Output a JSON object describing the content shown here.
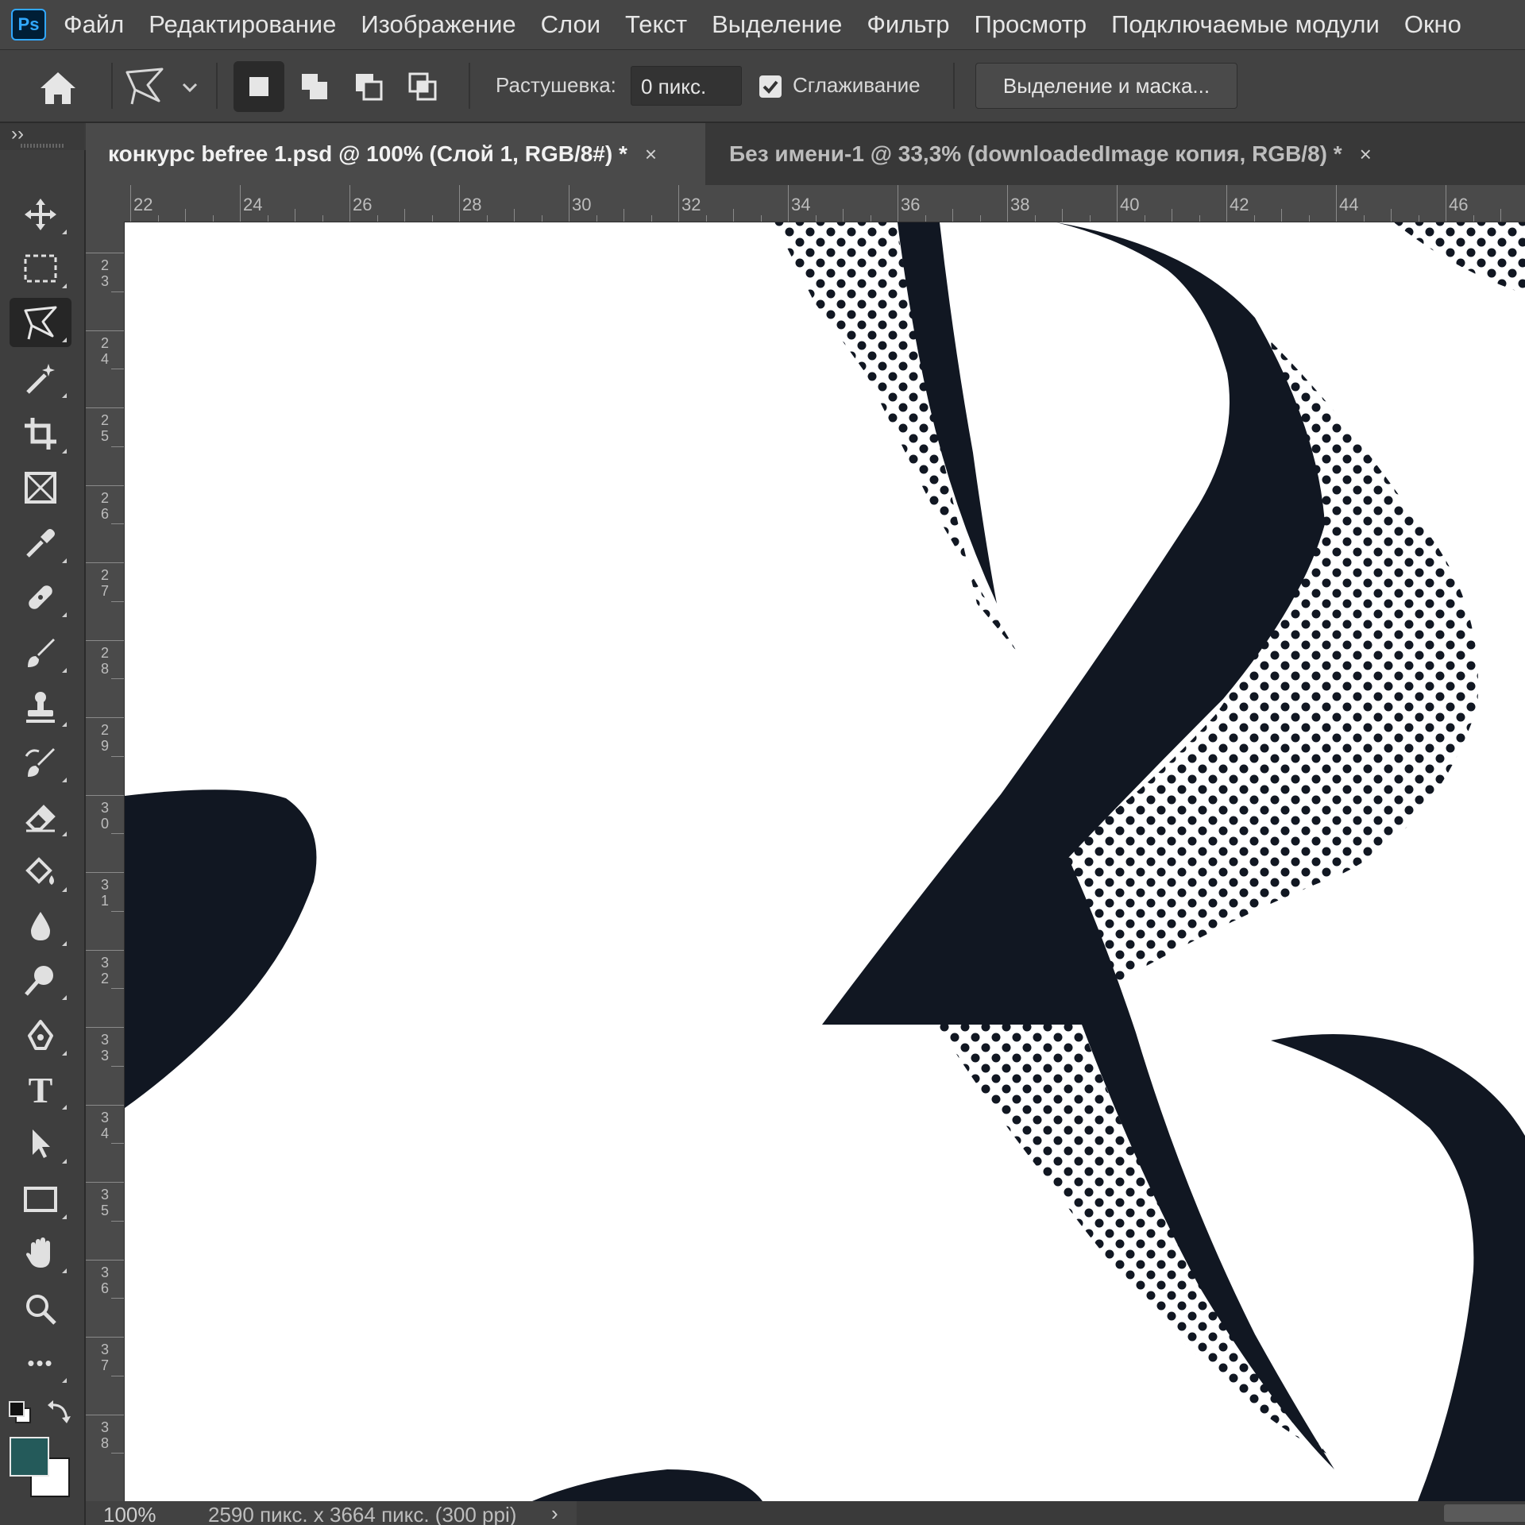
{
  "app": {
    "logo_text": "Ps"
  },
  "menu": [
    "Файл",
    "Редактирование",
    "Изображение",
    "Слои",
    "Текст",
    "Выделение",
    "Фильтр",
    "Просмотр",
    "Подключаемые модули",
    "Окно"
  ],
  "options": {
    "feather_label": "Растушевка:",
    "feather_value": "0 пикс.",
    "antialias_label": "Сглаживание",
    "antialias_checked": true,
    "select_mask_label": "Выделение и маска..."
  },
  "toolbar": {
    "collapse_glyph": "››",
    "tools": [
      "move-tool",
      "marquee-tool",
      "polygonal-lasso-tool",
      "magic-wand-tool",
      "crop-tool",
      "frame-tool",
      "eyedropper-tool",
      "healing-brush-tool",
      "brush-tool",
      "clone-stamp-tool",
      "history-brush-tool",
      "eraser-tool",
      "paint-bucket-tool",
      "blur-tool",
      "dodge-tool",
      "pen-tool",
      "type-tool",
      "path-selection-tool",
      "rectangle-tool",
      "hand-tool",
      "zoom-tool",
      "more-tools"
    ],
    "active_tool": "polygonal-lasso-tool",
    "foreground_color": "#245a5a",
    "background_color": "#ffffff",
    "type_glyph": "T",
    "more_glyph": "•••"
  },
  "tabs": [
    {
      "title": "конкурс befree 1.psd @ 100% (Слой 1, RGB/8#) *",
      "close": "×",
      "active": true
    },
    {
      "title": "Без имени-1 @ 33,3% (downloadedImage копия, RGB/8) *",
      "close": "×",
      "active": false
    }
  ],
  "rulers": {
    "horizontal": [
      "22",
      "24",
      "26",
      "28",
      "30",
      "32",
      "34",
      "36",
      "38",
      "40",
      "42",
      "44",
      "46"
    ],
    "vertical": [
      "23",
      "24",
      "25",
      "26",
      "27",
      "28",
      "29",
      "30",
      "31",
      "32",
      "33",
      "34",
      "35",
      "36",
      "37",
      "38"
    ]
  },
  "canvas": {
    "ink_color": "#111722",
    "background": "#ffffff"
  },
  "status": {
    "zoom": "100%",
    "doc_info": "2590 пикс. x 3664 пикс. (300 ppi)",
    "arrow": "›"
  }
}
